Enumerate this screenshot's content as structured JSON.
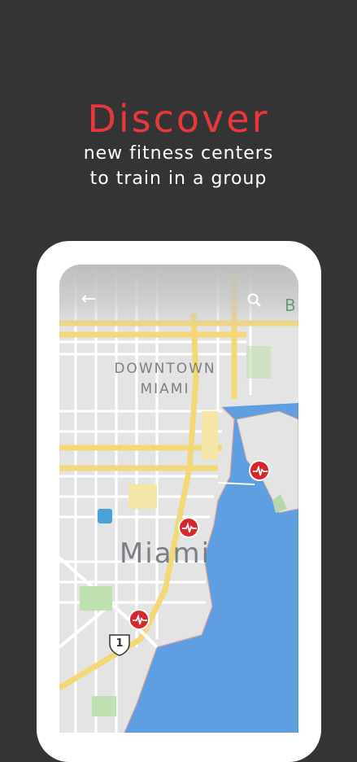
{
  "headline": "Discover",
  "subtitle_line1": "new fitness centers",
  "subtitle_line2": "to train in a group",
  "map": {
    "district_line1": "DOWNTOWN",
    "district_line2": "MIAMI",
    "city": "Miami",
    "poi_letter": "B",
    "route_shield": "1"
  },
  "icons": {
    "back": "back-arrow-icon",
    "search": "search-icon",
    "pin": "fitness-pin-icon",
    "transit": "transit-icon"
  },
  "colors": {
    "background": "#343434",
    "accent": "#e8383d",
    "pin": "#d8262c",
    "water": "#5f9ee0",
    "road": "#f3d877"
  }
}
